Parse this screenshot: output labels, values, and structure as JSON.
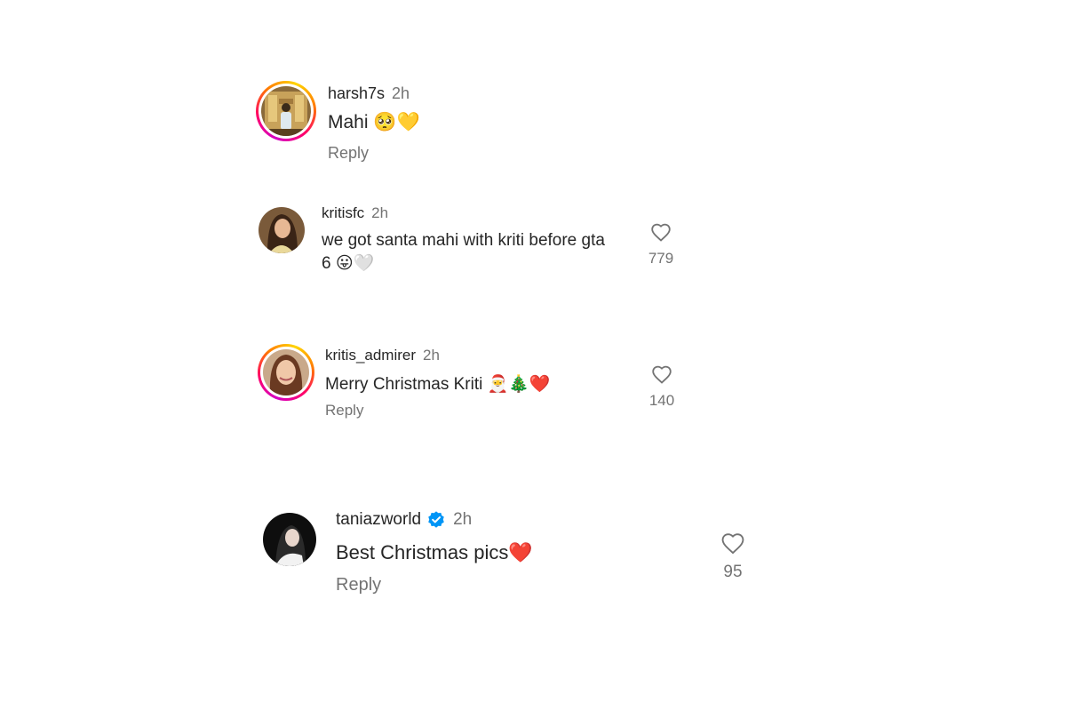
{
  "comments": [
    {
      "username": "harsh7s",
      "time": "2h",
      "text": "Mahi 🥺💛",
      "reply": "Reply",
      "avatar": "photo-man-in-room-avatar",
      "story_ring": true
    },
    {
      "username": "kritisfc",
      "time": "2h",
      "text_line1": "we got santa mahi with kriti before gta",
      "text_line2": "6 😛🤍",
      "likes": "779",
      "avatar": "photo-woman-avatar",
      "story_ring": false
    },
    {
      "username": "kritis_admirer",
      "time": "2h",
      "text": "Merry Christmas Kriti 🎅🎄❤️",
      "reply": "Reply",
      "likes": "140",
      "avatar": "photo-woman-smiling-avatar",
      "story_ring": true
    },
    {
      "username": "taniazworld",
      "time": "2h",
      "text": "Best Christmas pics❤️",
      "reply": "Reply",
      "likes": "95",
      "verified": true,
      "avatar": "photo-woman-dark-avatar",
      "story_ring": false
    }
  ],
  "colors": {
    "text": "#262626",
    "secondary": "#737373",
    "verified": "#0095f6"
  }
}
